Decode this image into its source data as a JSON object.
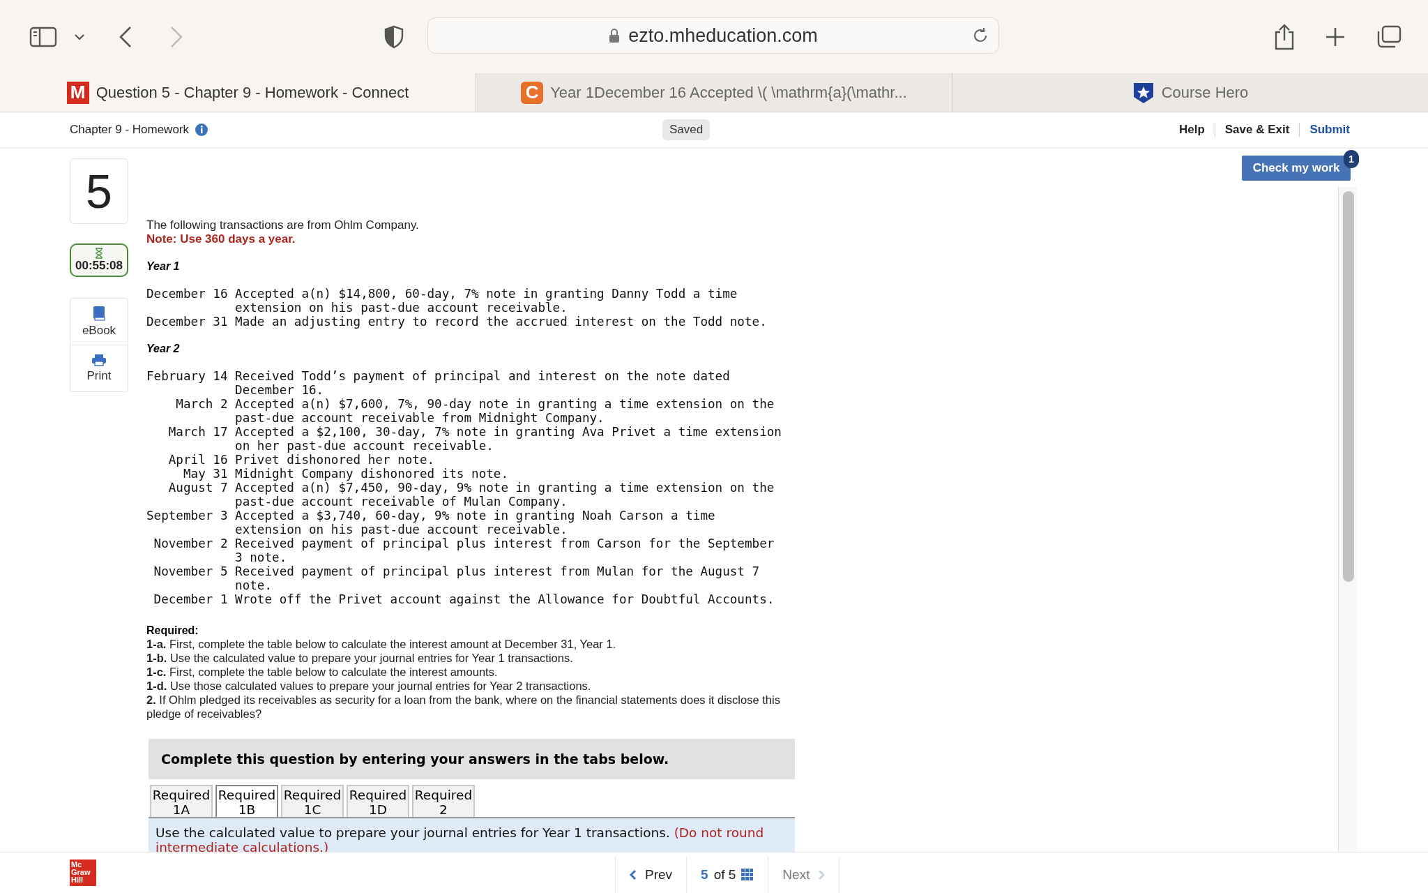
{
  "browser": {
    "address": "ezto.mheducation.com",
    "tabs": [
      {
        "title": "Question 5 - Chapter 9 - Homework - Connect",
        "icon_letter": "M",
        "color": "#d52b1e",
        "selected": true
      },
      {
        "title": "Year 1December 16 Accepted \\( \\mathrm{a}(\\mathr...",
        "icon_letter": "C",
        "color": "#e8702a",
        "selected": false
      },
      {
        "title": "Course Hero",
        "color": "#1d3f9a",
        "selected": false
      }
    ]
  },
  "header": {
    "title": "Chapter 9 - Homework",
    "status": "Saved",
    "links": [
      "Help",
      "Save & Exit",
      "Submit"
    ]
  },
  "sidebar": {
    "question_number": "5",
    "timer": "00:55:08",
    "tools": [
      {
        "label": "eBook",
        "kind": "book"
      },
      {
        "label": "Print",
        "kind": "print"
      }
    ]
  },
  "check_button": {
    "label": "Check my work",
    "badge": "1"
  },
  "question": {
    "intro": "The following transactions are from Ohlm Company.",
    "note": "Note: Use 360 days a year.",
    "years": [
      {
        "title": "Year 1",
        "transactions": [
          {
            "date": "December 16",
            "text": "Accepted a(n) $14,800, 60-day, 7% note in granting Danny Todd a time extension on his past-due account receivable."
          },
          {
            "date": "December 31",
            "text": "Made an adjusting entry to record the accrued interest on the Todd note."
          }
        ]
      },
      {
        "title": "Year 2",
        "transactions": [
          {
            "date": "February 14",
            "text": "Received Todd’s payment of principal and interest on the note dated December 16."
          },
          {
            "date": "March 2",
            "text": "Accepted a(n) $7,600, 7%, 90-day note in granting a time extension on the past-due account receivable from Midnight Company."
          },
          {
            "date": "March 17",
            "text": "Accepted a $2,100, 30-day, 7% note in granting Ava Privet a time extension on her past-due account receivable."
          },
          {
            "date": "April 16",
            "text": "Privet dishonored her note."
          },
          {
            "date": "May 31",
            "text": "Midnight Company dishonored its note."
          },
          {
            "date": "August 7",
            "text": "Accepted a(n) $7,450, 90-day, 9% note in granting a time extension on the past-due account receivable of Mulan Company."
          },
          {
            "date": "September 3",
            "text": "Accepted a $3,740, 60-day, 9% note in granting Noah Carson a time extension on his past-due account receivable."
          },
          {
            "date": "November 2",
            "text": "Received payment of principal plus interest from Carson for the September 3 note."
          },
          {
            "date": "November 5",
            "text": "Received payment of principal plus interest from Mulan for the August 7 note."
          },
          {
            "date": "December 1",
            "text": "Wrote off the Privet account against the Allowance for Doubtful Accounts."
          }
        ]
      }
    ],
    "required_title": "Required:",
    "requirements": [
      "**1-a.** First, complete the table below to calculate the interest amount at December 31, Year 1.",
      "**1-b.** Use the calculated value to prepare your journal entries for Year 1 transactions.",
      "**1-c.** First, complete the table below to calculate the interest amounts.",
      "**1-d.** Use those calculated values to prepare your journal entries for Year 2 transactions.",
      "**2.** If Ohlm pledged its receivables as security for a loan from the bank, where on the financial statements does it disclose this pledge of receivables?"
    ]
  },
  "answer_panel": {
    "banner": "Complete this question by entering your answers in the tabs below.",
    "tabs": [
      {
        "label": "Required 1A",
        "selected": false
      },
      {
        "label": "Required 1B",
        "selected": true
      },
      {
        "label": "Required 1C",
        "selected": false
      },
      {
        "label": "Required 1D",
        "selected": false
      },
      {
        "label": "Required 2",
        "selected": false
      }
    ],
    "instruction": "Use the calculated value to prepare your journal entries for Year 1 transactions.",
    "instruction_note": "(Do not round intermediate calculations.)"
  },
  "footer": {
    "logo": [
      "Mc",
      "Graw",
      "Hill"
    ],
    "prev": "Prev",
    "page_current": "5",
    "page_rest": "of 5",
    "next": "Next",
    "next_disabled": true
  }
}
